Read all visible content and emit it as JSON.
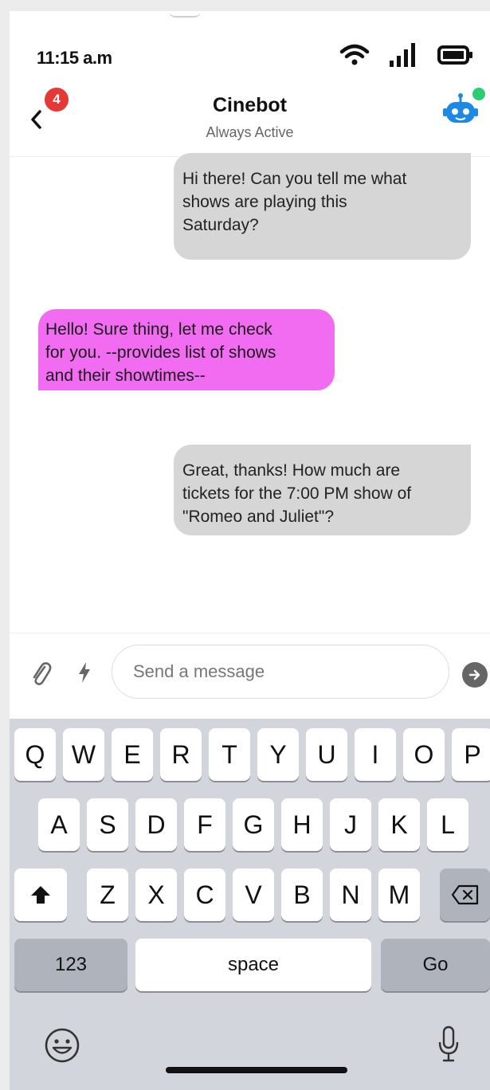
{
  "status_bar": {
    "time": "11:15 a.m"
  },
  "header": {
    "badge_count": "4",
    "title": "Cinebot",
    "subtitle": "Always Active"
  },
  "messages": [
    {
      "from": "user",
      "text": "Hi there! Can you tell me what\nshows are playing this\nSaturday?"
    },
    {
      "from": "bot",
      "text": "Hello! Sure thing, let me check\nfor you. --provides list of shows\nand their showtimes--"
    },
    {
      "from": "user",
      "text": "Great, thanks! How much are\ntickets for the 7:00 PM show of\n\"Romeo and Juliet\"?"
    }
  ],
  "composer": {
    "placeholder": "Send a message"
  },
  "keyboard": {
    "row1": [
      "Q",
      "W",
      "E",
      "R",
      "T",
      "Y",
      "U",
      "I",
      "O",
      "P"
    ],
    "row2": [
      "A",
      "S",
      "D",
      "F",
      "G",
      "H",
      "J",
      "K",
      "L"
    ],
    "row3": [
      "Z",
      "X",
      "C",
      "V",
      "B",
      "N",
      "M"
    ],
    "numbers_label": "123",
    "space_label": "space",
    "go_label": "Go"
  },
  "colors": {
    "bot_bubble": "#f16cf1",
    "user_bubble": "#d6d6d6",
    "badge": "#e53935",
    "online": "#2ecc71",
    "bot_avatar": "#1e88e5"
  }
}
